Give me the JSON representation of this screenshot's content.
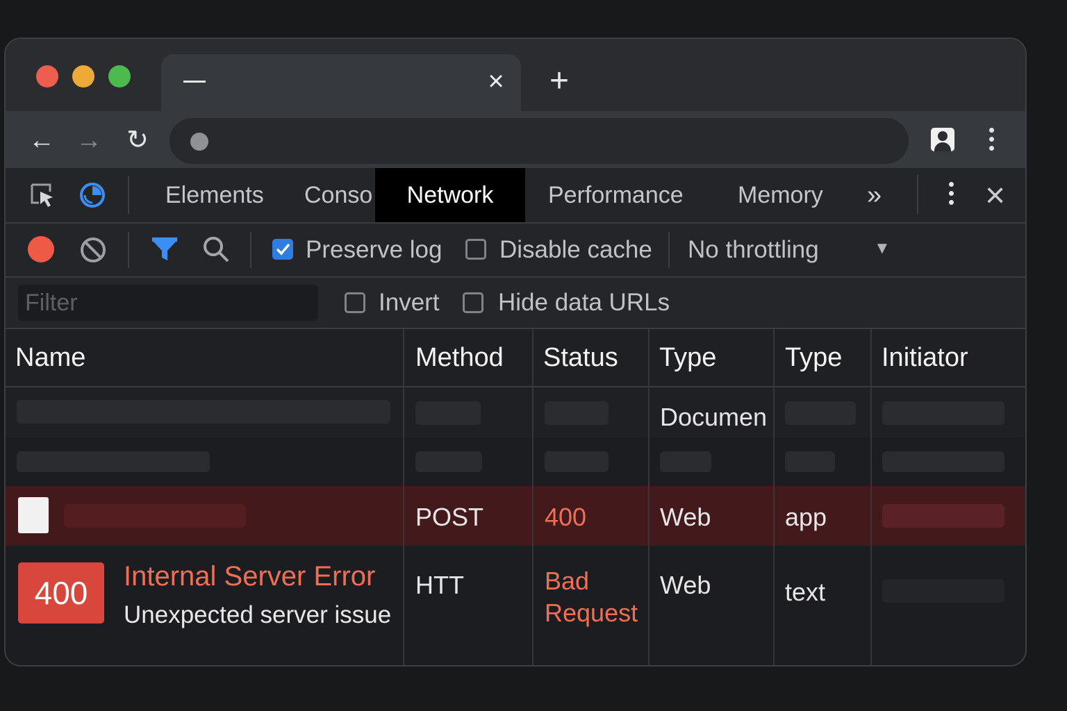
{
  "browser": {
    "traffic_lights": [
      "#ee5e50",
      "#eeaa38",
      "#4cba4d"
    ],
    "tab_close_icon": "×",
    "new_tab_icon": "+",
    "nav": {
      "back_icon": "←",
      "forward_icon": "→",
      "reload_icon": "↻"
    },
    "menu_icon": "⋮"
  },
  "devtools": {
    "tabs": [
      "Elements",
      "Conso",
      "Network",
      "Performance",
      "Memory"
    ],
    "active_tab": "Network",
    "more_tabs_icon": "»",
    "close_icon": "×"
  },
  "network_toolbar": {
    "record_color": "#ef5a47",
    "preserve_log": {
      "label": "Preserve log",
      "checked": true
    },
    "disable_cache": {
      "label": "Disable cache",
      "checked": false
    },
    "throttling": {
      "value": "No throttling",
      "arrow": "▼"
    }
  },
  "filter_bar": {
    "placeholder": "Filter",
    "invert": {
      "label": "Invert",
      "checked": false
    },
    "hide_data_urls": {
      "label": "Hide data URLs",
      "checked": false
    }
  },
  "table": {
    "columns": [
      "Name",
      "Method",
      "Status",
      "Type",
      "Type",
      "Initiator"
    ],
    "rows": [
      {
        "type": "Documen"
      },
      {},
      {
        "method": "POST",
        "status": "400",
        "type": "Web",
        "type2": "app"
      },
      {
        "error_code": "400",
        "error_title": "Internal Server Error",
        "error_subtitle": "Unexpected server issue",
        "method": "HTT",
        "status_line1": "Bad",
        "status_line2": "Request",
        "type": "Web",
        "type2": "text"
      }
    ]
  }
}
